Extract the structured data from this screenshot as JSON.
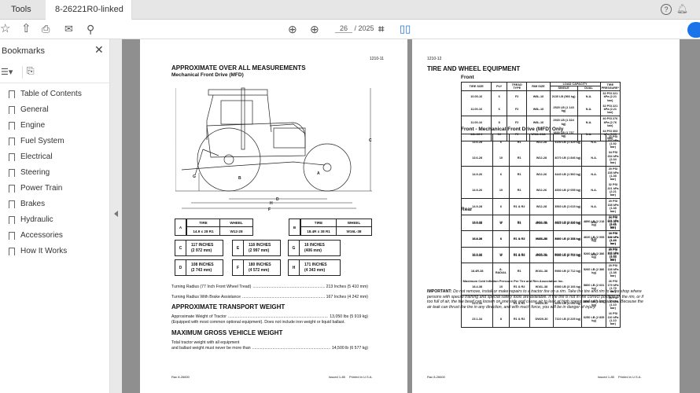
{
  "tabs": {
    "tools": "Tools",
    "document": "8-26221R0-linked p...",
    "close": "×"
  },
  "toolbar": {
    "current_page": "26",
    "total_pages": "/ 2025",
    "help": "?"
  },
  "sidebar": {
    "title": "Bookmarks",
    "close": "✕",
    "items": [
      {
        "label": "Table of Contents"
      },
      {
        "label": "General"
      },
      {
        "label": "Engine"
      },
      {
        "label": "Fuel System"
      },
      {
        "label": "Electrical"
      },
      {
        "label": "Steering"
      },
      {
        "label": "Power Train"
      },
      {
        "label": "Brakes"
      },
      {
        "label": "Hydraulic"
      },
      {
        "label": "Accessories"
      },
      {
        "label": "How It Works"
      }
    ]
  },
  "colors": {
    "accent": "#1a73e8",
    "viewer_bg": "#8f8f8f"
  },
  "page_left": {
    "page_number": "1210-11",
    "title": "APPROXIMATE OVER ALL MEASUREMENTS",
    "subtitle": "Mechanical Front Drive (MFD)",
    "diagram_labels": {
      "A": "A",
      "B": "B",
      "C": "C",
      "D": "D",
      "E": "E",
      "F": "F",
      "G": "G",
      "H": "H"
    },
    "tire_wheel": [
      {
        "letter": "A",
        "tire_header": "TIRE",
        "wheel_header": "WHEEL",
        "tire": "14.9 x 28 R1",
        "wheel": "W12-28"
      },
      {
        "letter": "B",
        "tire_header": "TIRE",
        "wheel_header": "WHEEL",
        "tire": "18.4R x 38 R1",
        "wheel": "W16L-38"
      }
    ],
    "measurements": [
      {
        "letter": "C",
        "inches": "117 INCHES",
        "mm": "(2 972 mm)"
      },
      {
        "letter": "E",
        "inches": "118 INCHES",
        "mm": "(2 997 mm)"
      },
      {
        "letter": "G",
        "inches": "16 INCHES",
        "mm": "(406 mm)"
      },
      {
        "letter": "D",
        "inches": "108 INCHES",
        "mm": "(2 743 mm)"
      },
      {
        "letter": "F",
        "inches": "180 INCHES",
        "mm": "(4 572 mm)"
      },
      {
        "letter": "H",
        "inches": "171 INCHES",
        "mm": "(4 343 mm)"
      }
    ],
    "turning_radius_1": {
      "label": "Turning Radius (77 Inch Front Wheel Tread)",
      "value": "213 Inches (5 410 mm)"
    },
    "turning_radius_2": {
      "label": "Turning Radius With Brake Assistance",
      "value": "167 Inches (4 242 mm)"
    },
    "transport_heading": "APPROXIMATE TRANSPORT WEIGHT",
    "transport_weight": {
      "label": "Approximate Weight of Tractor",
      "value": "13,050 lbs (5 919 kg)",
      "note": "(Equipped with most common optional equipment). Does not include iron weight or liquid ballast."
    },
    "gross_heading": "MAXIMUM GROSS VEHICLE WEIGHT",
    "gross_weight": {
      "line1": "Total tractor weight with all equipment",
      "line2": "and ballast weight must never be more than",
      "value": "14,500 lb (6 577 kg)"
    },
    "footer": {
      "left": "Rac 8-26600",
      "issued": "Issued 1-85",
      "printed": "Printed in U.S.A."
    }
  },
  "page_right": {
    "page_number": "1210-12",
    "title": "TIRE AND WHEEL EQUIPMENT",
    "columns": [
      "TIRE SIZE",
      "PLY",
      "TREAD TYPE",
      "RIM SIZE",
      "LOAD CAPACITY",
      "TIRE PRESSURE*"
    ],
    "load_sub": [
      "SINGLE",
      "DUAL"
    ],
    "sections": [
      {
        "title": "Front",
        "groups_start": [
          0,
          2
        ],
        "rows": [
          [
            "10.00-16",
            "6",
            "F2",
            "W8L-16",
            "2130 LB (966 kg)",
            "N.A.",
            "32 PSI 221 kPa (2.21 bar)"
          ],
          [
            "11.00-16",
            "6",
            "F2",
            "W8L-16",
            "2520 LB (1 143 kg)",
            "N.A.",
            "32 PSI 221 kPa (2.21 bar)"
          ],
          [
            "11.00-16",
            "8",
            "F2",
            "W8L-16",
            "2920 LB (1 324 kg)",
            "N.A.",
            "40 PSI 276 kPa (2.76 bar)"
          ],
          [
            "14L-16.1",
            "10",
            "F2",
            "W11L-16A",
            "3830 LB (1 737 kg)",
            "N.A.",
            "44 PSI 303 kPa (3.03 bar)"
          ]
        ]
      },
      {
        "title": "Front - Mechanical Front Drive (MFD) Only",
        "groups_start": [
          0,
          2,
          4,
          6
        ],
        "rows": [
          [
            "13.6-28",
            "6",
            "R1",
            "W12-28",
            "3150 LB (1 429 kg)",
            "N.A.",
            "22 PSI 152 kPa (1.52 bar)"
          ],
          [
            "13.6-28",
            "10",
            "R1",
            "W12-28",
            "4070 LB (1 846 kg)",
            "N.A.",
            "34 PSI 234 kPa (2.34 bar)"
          ],
          [
            "14.9-26",
            "6",
            "R1",
            "W12-26",
            "3440 LB (1 560 kg)",
            "N.A.",
            "20 PSI 138 kPa (1.38 bar)"
          ],
          [
            "14.9-26",
            "10",
            "R1",
            "W12-26",
            "4530 LB (2 055 kg)",
            "N.A.",
            "32 PSI 221 kPa (2.21 bar)"
          ],
          [
            "14.9-28",
            "6",
            "R1 & R2",
            "W12-28",
            "3560 LB (1 615 kg)",
            "N.A.",
            "20 PSI 138 kPa (1.38 bar)"
          ],
          [
            "14.9-28",
            "10",
            "R1",
            "W12-28",
            "4670 LB (2 118 kg)",
            "N.A.",
            "32 PSI 221 kPa (2.21 bar)"
          ],
          [
            "16.9-26",
            "6",
            "R1 & R2",
            "W15-26",
            "3920 LB (1 778 kg)",
            "N.A.",
            "18 PSI 124 kPa (1.24 bar)"
          ],
          [
            "16.9-26",
            "10",
            "R1 & R2",
            "W15-26",
            "5080 LB (2 304 kg)",
            "N.A.",
            "28 PSI 193 kPa (1.93 bar)"
          ]
        ]
      },
      {
        "title": "Rear",
        "groups_start": [
          0,
          2,
          5
        ],
        "rows": [
          [
            "15.9-38",
            "8",
            "R1",
            "W16L-38",
            "5560 LB (2 522 kg)",
            "4890 LB (2 218 kg)",
            "24 PSI 165 kPa (1.65 bar)"
          ],
          [
            "18.4-38",
            "6",
            "R1 & R2",
            "W16L-38",
            "5260 LB (2 381 kg)",
            "4620 LB (2 095 kg)",
            "16 PSI 110 kPa (1.10 bar)"
          ],
          [
            "18.4-38",
            "8",
            "R1 & R2",
            "W16L-38",
            "5980 LB (2 712 kg)",
            "5260 LB (2 386 kg)",
            "20 PSI 138 kPa (1.38 bar)"
          ],
          [
            "18.4R-38",
            "8-RADIAL",
            "R1",
            "W16L-38",
            "5980 LB (2 712 kg)",
            "5260 LB (2 386 kg)",
            "20 PSI 138 kPa (1.38 bar)"
          ],
          [
            "18.4-38",
            "10",
            "R1 & R2",
            "W16L-38",
            "6980 LB (3 166 kg)",
            "5800 LB (2 631 kg)",
            "26 PSI 179 kPa (1.79 bar)"
          ],
          [
            "23.1-30",
            "8",
            "R1 & R2",
            "DW20-30",
            "6690 LB (3 034 kg)",
            "5890 LB (2 672 kg)",
            "16 PSI 110 kPa (1.10 bar)"
          ],
          [
            "23.1-34",
            "8",
            "R1 & R2",
            "DW20-30",
            "7110 LB (3 225 kg)",
            "6250 LB (2 835 kg)",
            "16 PSI 110 kPa (1.10 bar)"
          ]
        ]
      }
    ],
    "footnote": "* Maximum Cold Inflation Pressure Per Tire and Rim Association Inc.",
    "important_label": "IMPORTANT:",
    "important_text": "Do not remove, install or make repairs to a tractor tire on a rim. Take the tire and rim to a tire shop where persons with special training and special safety tools are available. If the tire is not in the correct position on the rim, or if too full of air, the tire bead can loosen on one side and cause air to leak at high speed and with large force. Because the air leak can thrust the tire in any direction, and with much force, you will be in danger of injury.",
    "footer": {
      "left": "Rac 8-26600",
      "issued": "Issued 1-85",
      "printed": "Printed in U.S.A."
    }
  }
}
